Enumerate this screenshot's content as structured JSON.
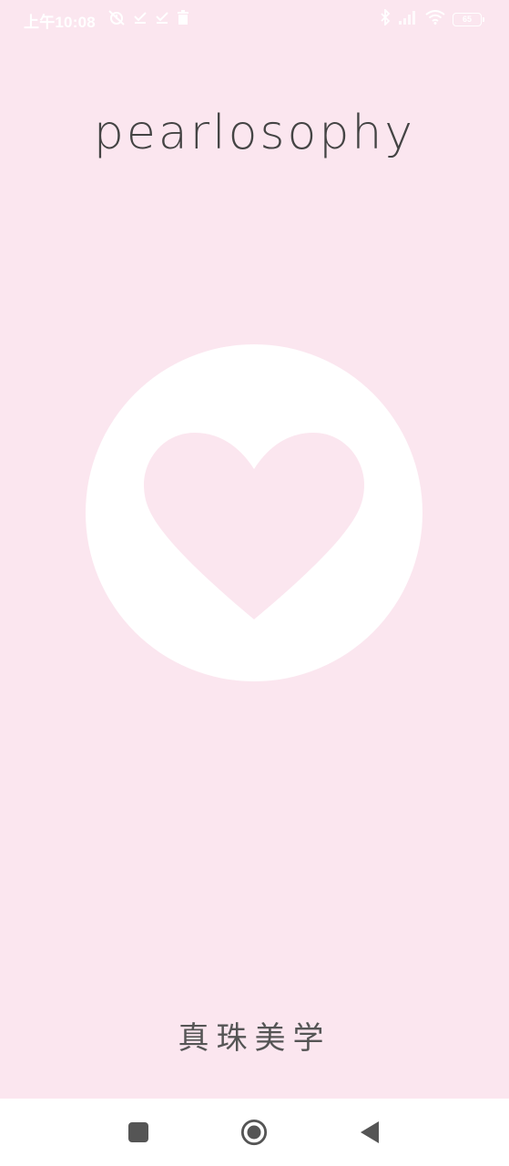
{
  "status_bar": {
    "time": "上午10:08",
    "battery_level": "65",
    "left_icons": [
      "alarm-off-icon",
      "check-download-icon",
      "check-download-icon",
      "trash-icon"
    ],
    "right_icons": [
      "bluetooth-icon",
      "signal-icon",
      "wifi-icon",
      "battery-icon"
    ]
  },
  "brand": {
    "logo_text": "pearlosophy"
  },
  "hero": {
    "icon": "heart-icon",
    "circle_color": "#ffffff",
    "heart_color": "#fbe6ef"
  },
  "tagline": {
    "text": "真珠美学"
  },
  "nav_bar": {
    "buttons": [
      "recents-square-icon",
      "home-circle-icon",
      "back-triangle-icon"
    ]
  },
  "colors": {
    "background": "#fbe6ef",
    "text_dark": "#444444",
    "nav_icon": "#555555"
  }
}
